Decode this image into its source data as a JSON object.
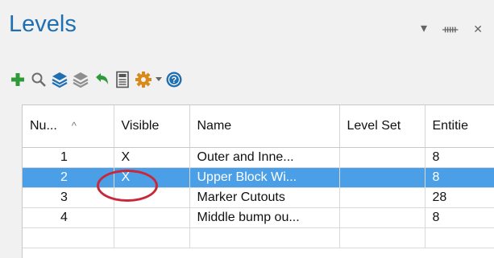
{
  "panel": {
    "title": "Levels",
    "controls": {
      "dropdown_glyph": "▾",
      "pin_glyph": "ᚔ",
      "close_glyph": "✕"
    }
  },
  "toolbar": {
    "icons": [
      "plus-icon",
      "search-icon",
      "layers-icon",
      "layers-gray-icon",
      "undo-icon",
      "calculator-icon",
      "gear-icon",
      "help-icon"
    ],
    "colors": {
      "green": "#2f9a3a",
      "blue": "#1f6fb2",
      "gray": "#8e8e8e",
      "orange": "#d88a1b"
    }
  },
  "table": {
    "columns": [
      "Nu...",
      "Visible",
      "Name",
      "Level Set",
      "Entitie"
    ],
    "sort_glyph": "^",
    "rows": [
      {
        "number": "1",
        "visible": "X",
        "name": "Outer and Inne...",
        "level_set": "",
        "entities": "8"
      },
      {
        "number": "2",
        "visible": "X",
        "name": "Upper Block Wi...",
        "level_set": "",
        "entities": "8"
      },
      {
        "number": "3",
        "visible": "",
        "name": "Marker Cutouts",
        "level_set": "",
        "entities": "28"
      },
      {
        "number": "4",
        "visible": "",
        "name": "Middle bump ou...",
        "level_set": "",
        "entities": "8"
      }
    ],
    "selected_row": 1
  },
  "annotation": {
    "circle_color": "#c8283a"
  }
}
